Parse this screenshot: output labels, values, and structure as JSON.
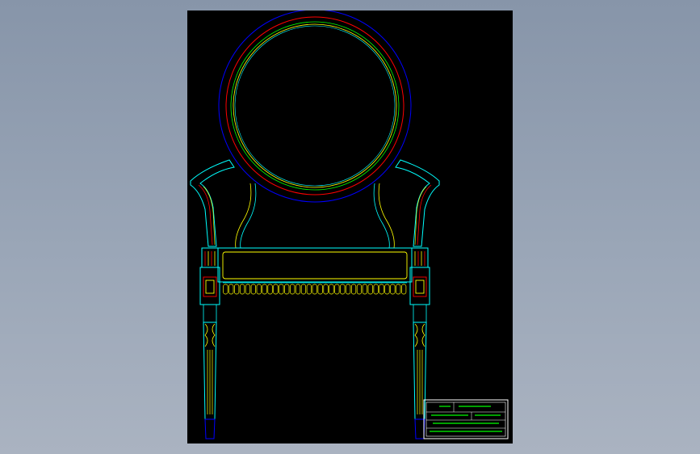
{
  "drawing": {
    "subject": "chair-front-elevation",
    "background": "#000000",
    "line_colors": {
      "outline": "#0000ff",
      "accent": "#ff0000",
      "detail": "#ffff00",
      "edge": "#00ffff",
      "title": "#00ff00",
      "frame": "#ffffff"
    }
  },
  "title_block": {
    "line1": "",
    "line2": "",
    "line3": "",
    "line4": ""
  }
}
